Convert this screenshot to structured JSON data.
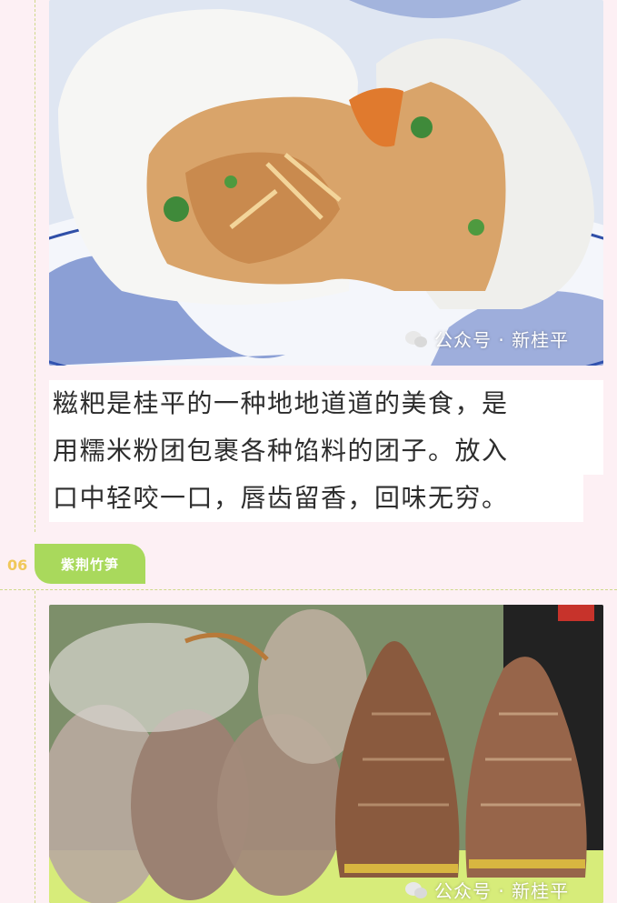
{
  "section1": {
    "photo_alt": "glutinous rice dumpling with filling",
    "watermark": "公众号 · 新桂平",
    "caption_lines": [
      "糍粑是桂平的一种地地道道的美食，是",
      "用糯米粉团包裹各种馅料的团子。放入",
      "口中轻咬一口，唇齿留香，回味无穷。"
    ]
  },
  "section2": {
    "number": "06",
    "title": "紫荆竹笋",
    "photo_alt": "dried bamboo shoots in bags",
    "watermark": "公众号 · 新桂平"
  },
  "colors": {
    "background": "#fdf0f4",
    "badge": "#a9d95c",
    "number": "#f0c85a",
    "dashed": "#cfd88a"
  },
  "icons": [
    "wechat-icon"
  ]
}
